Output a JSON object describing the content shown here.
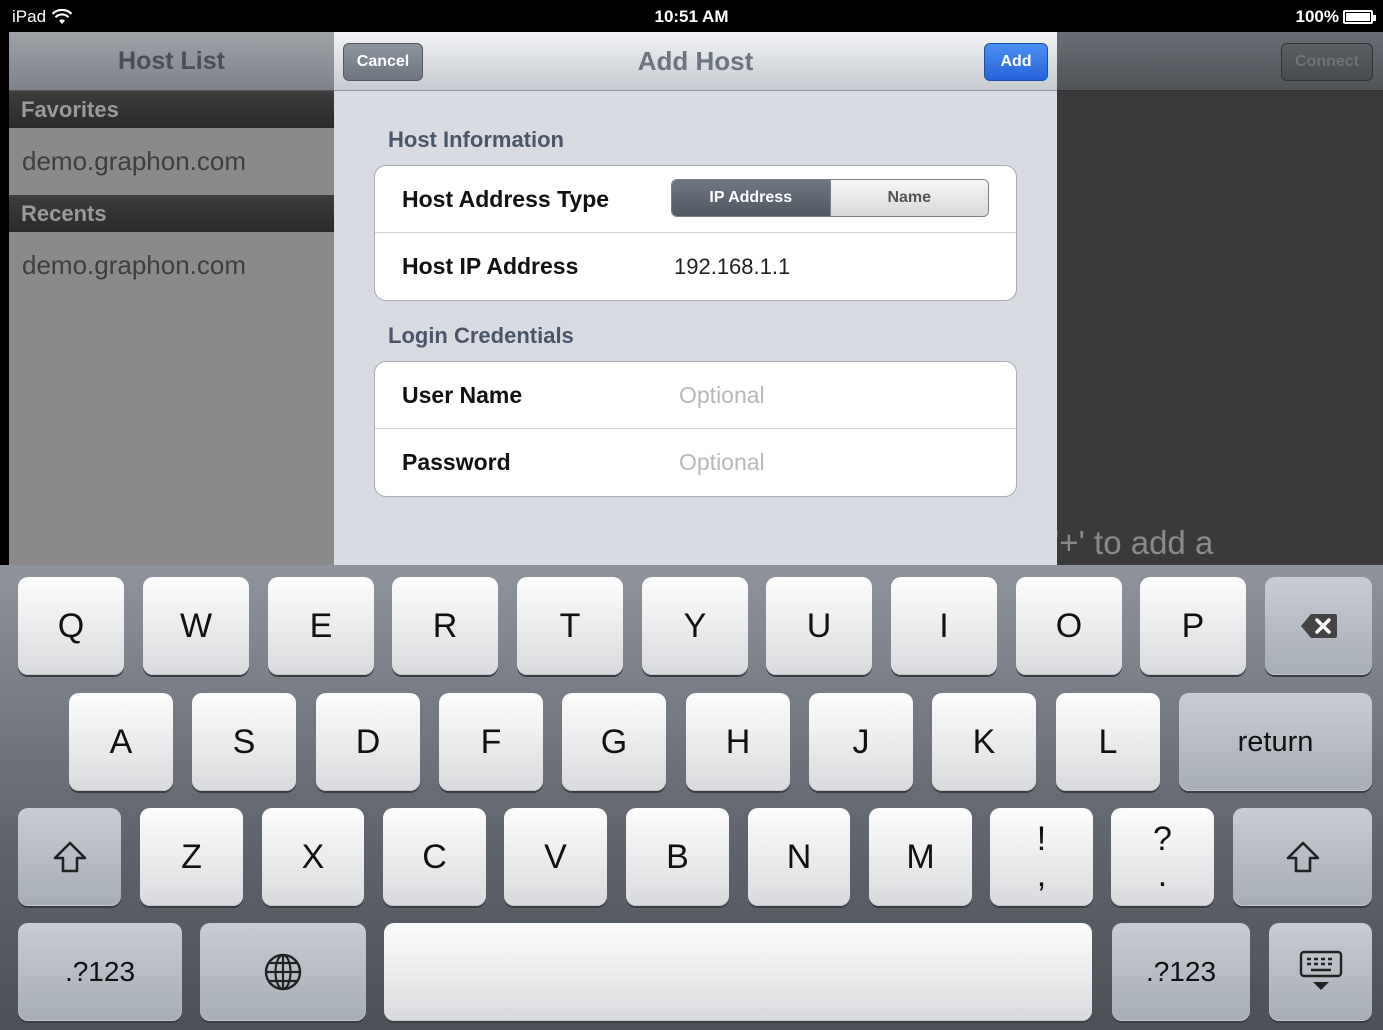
{
  "status_bar": {
    "carrier": "iPad",
    "time": "10:51 AM",
    "battery": "100%"
  },
  "host_list": {
    "title": "Host List",
    "sections": [
      {
        "header": "Favorites",
        "items": [
          "demo.graphon.com"
        ]
      },
      {
        "header": "Recents",
        "items": [
          "demo.graphon.com"
        ]
      }
    ]
  },
  "detail": {
    "connect_label": "Connect",
    "hint": "'+' to add a"
  },
  "modal": {
    "title": "Add Host",
    "cancel_label": "Cancel",
    "add_label": "Add",
    "host_info": {
      "header": "Host Information",
      "address_type_label": "Host Address Type",
      "segments": [
        "IP Address",
        "Name"
      ],
      "selected_segment": "IP Address",
      "ip_label": "Host IP Address",
      "ip_value": "192.168.1.1"
    },
    "login": {
      "header": "Login Credentials",
      "username_label": "User Name",
      "username_placeholder": "Optional",
      "password_label": "Password",
      "password_placeholder": "Optional"
    }
  },
  "keyboard": {
    "row1": [
      "Q",
      "W",
      "E",
      "R",
      "T",
      "Y",
      "U",
      "I",
      "O",
      "P"
    ],
    "row2": [
      "A",
      "S",
      "D",
      "F",
      "G",
      "H",
      "J",
      "K",
      "L"
    ],
    "return_label": "return",
    "row3": [
      "Z",
      "X",
      "C",
      "V",
      "B",
      "N",
      "M"
    ],
    "punct1": [
      "!",
      ","
    ],
    "punct2": [
      "?",
      "."
    ],
    "numbers_label": ".?123",
    "icons": [
      "backspace-icon",
      "shift-icon",
      "globe-icon",
      "keyboard-dismiss-icon"
    ]
  }
}
